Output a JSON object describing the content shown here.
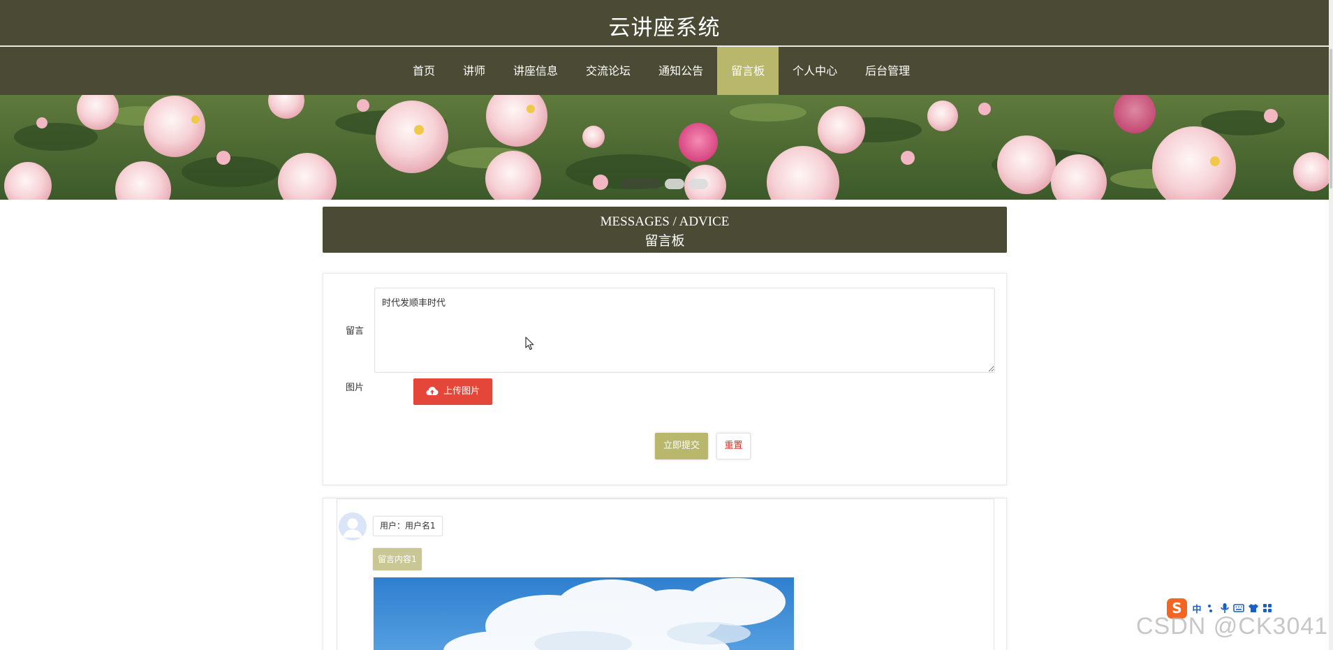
{
  "site": {
    "title": "云讲座系统"
  },
  "nav": {
    "items": [
      {
        "label": "首页"
      },
      {
        "label": "讲师"
      },
      {
        "label": "讲座信息"
      },
      {
        "label": "交流论坛"
      },
      {
        "label": "通知公告"
      },
      {
        "label": "留言板",
        "active": true
      },
      {
        "label": "个人中心"
      },
      {
        "label": "后台管理"
      }
    ]
  },
  "banner": {
    "slides_count": 3,
    "active_slide": 1
  },
  "section": {
    "title_en": "MESSAGES / ADVICE",
    "title_cn": "留言板"
  },
  "form": {
    "message_label": "留言",
    "message_value": "时代发顺丰时代",
    "image_label": "图片",
    "upload_label": "上传图片",
    "submit_label": "立即提交",
    "reset_label": "重置"
  },
  "messages": [
    {
      "user_label": "用户：用户名1",
      "content": "留言内容1"
    }
  ],
  "ime": {
    "lang": "中",
    "logo": "S"
  },
  "watermark": "CSDN @CK3041",
  "colors": {
    "header_bg": "#4b4b35",
    "accent": "#b9b76b",
    "danger": "#e4473a"
  }
}
